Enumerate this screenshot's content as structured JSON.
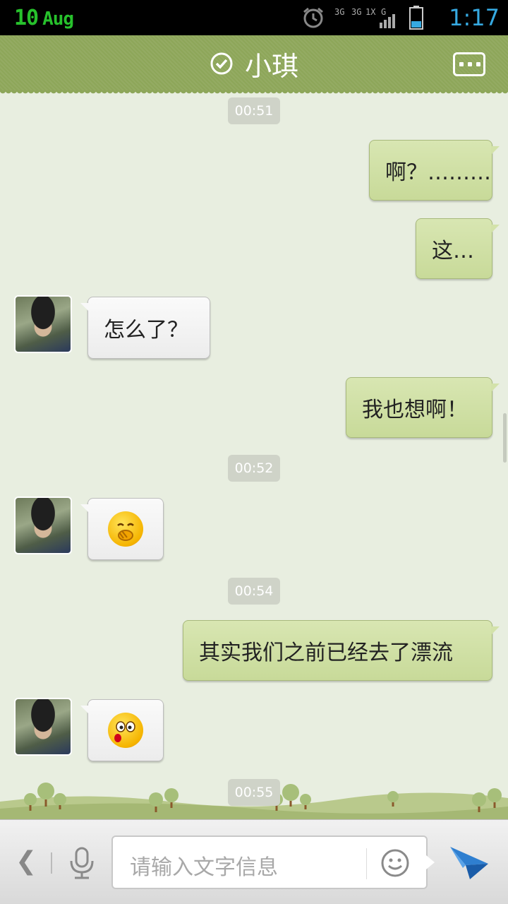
{
  "status_bar": {
    "date_day": "10",
    "date_month": "Aug",
    "time": "1:17",
    "network_labels": [
      "3G",
      "3G",
      "1X",
      "G"
    ]
  },
  "header": {
    "title": "小琪",
    "verified_icon": "check-circle-icon",
    "menu_icon": "more-dots-icon"
  },
  "messages": {
    "ts1": "00:51",
    "m1": "啊？………",
    "m2": "这…",
    "m3": "怎么了？",
    "m4": "我也想啊！",
    "ts2": "00:52",
    "m5_emoji": "shy-emoji",
    "ts3": "00:54",
    "m6": "其实我们之前已经去了漂流",
    "m7_emoji": "surprised-emoji",
    "ts4": "00:55"
  },
  "input_bar": {
    "placeholder": "请输入文字信息",
    "back_icon": "chevron-left-icon",
    "mic_icon": "microphone-icon",
    "emoji_icon": "smiley-icon",
    "send_icon": "send-arrow-icon"
  },
  "colors": {
    "title_bar": "#8da659",
    "outgoing_bubble": "#cddd9f",
    "incoming_bubble": "#f5f5f5",
    "chat_background": "#e8eee0",
    "time_accent": "#36a9e1",
    "date_accent": "#27c12c"
  }
}
